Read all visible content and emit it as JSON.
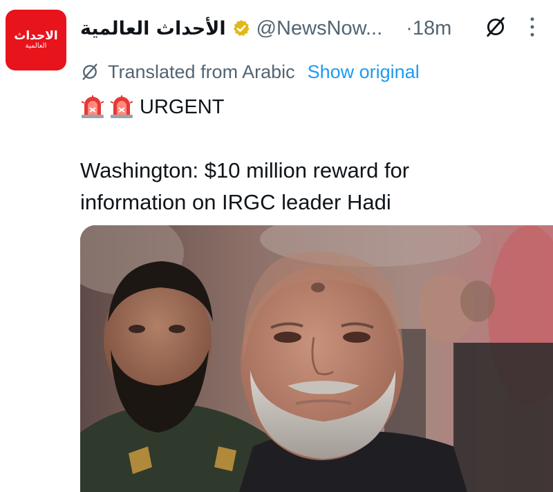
{
  "account": {
    "avatar_logo_text": "الاحداث",
    "avatar_logo_subtext": "العالمية",
    "display_name": "الأحداث العالمية",
    "verified_icon": "verified-badge-icon",
    "handle": "@NewsNow...",
    "time": "·18m"
  },
  "header_icons": {
    "grok": "grok-icon",
    "more": "more-options-icon"
  },
  "translation": {
    "icon": "translate-icon",
    "label": "Translated from Arabic",
    "show_original": "Show original"
  },
  "tweet": {
    "urgent_label": "URGENT",
    "urgent_emoji": "police-siren-emoji",
    "text_line1": "Washington: $10 million reward for",
    "text_line2": "information on IRGC leader Hadi"
  },
  "colors": {
    "brand_red": "#e8141c",
    "link_blue": "#1d9bf0",
    "muted": "#536471",
    "verified_gold": "#e2b719"
  }
}
